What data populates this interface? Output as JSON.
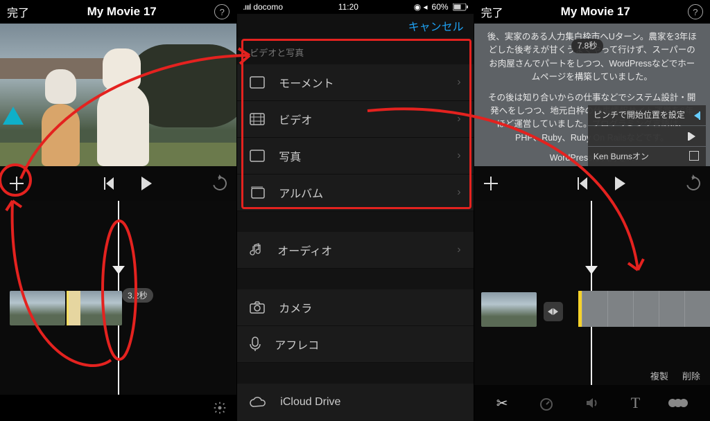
{
  "screen1": {
    "header": {
      "done": "完了",
      "title": "My Movie 17"
    },
    "transport": {
      "duration_bubble": "3.2秒"
    }
  },
  "screen2": {
    "status": {
      "carrier": "docomo",
      "signal": ".ıııl",
      "time": "11:20",
      "battery": "60%",
      "loc_icon": "◉ ◂"
    },
    "cancel": "キャンセル",
    "section_label": "ビデオと写真",
    "media_rows": [
      {
        "label": "モーメント"
      },
      {
        "label": "ビデオ"
      },
      {
        "label": "写真"
      },
      {
        "label": "アルバム"
      }
    ],
    "other_rows": [
      {
        "label": "オーディオ"
      },
      {
        "label": "カメラ"
      },
      {
        "label": "アフレコ"
      },
      {
        "label": "iCloud Drive"
      }
    ]
  },
  "screen3": {
    "header": {
      "done": "完了",
      "title": "My Movie 17"
    },
    "preview_text": {
      "p1": "後、実家のある人力集白枠市へUターン。農家を3年ほどした後考えが甘くうまくやって行けず、スーパーのお肉屋さんでパートをしつつ、WordPressなどでホームページを構築していました。",
      "p2": "その後は知り合いからの仕事などでシステム設計・開発へをしつつ、地元白枠の仕事情報サイト運営を6年ほど運営していました。プログラミング言語は、PHP、Ruby、Ruby On Railsなどです。",
      "p3": "WordPressは大好き..."
    },
    "time_chip": "7.8秒",
    "toolpop": {
      "r1": "ピンチで開始位置を設定",
      "r2": "",
      "r3": "Ken Burnsオン"
    },
    "edit_labels": {
      "dup": "複製",
      "del": "削除"
    }
  }
}
